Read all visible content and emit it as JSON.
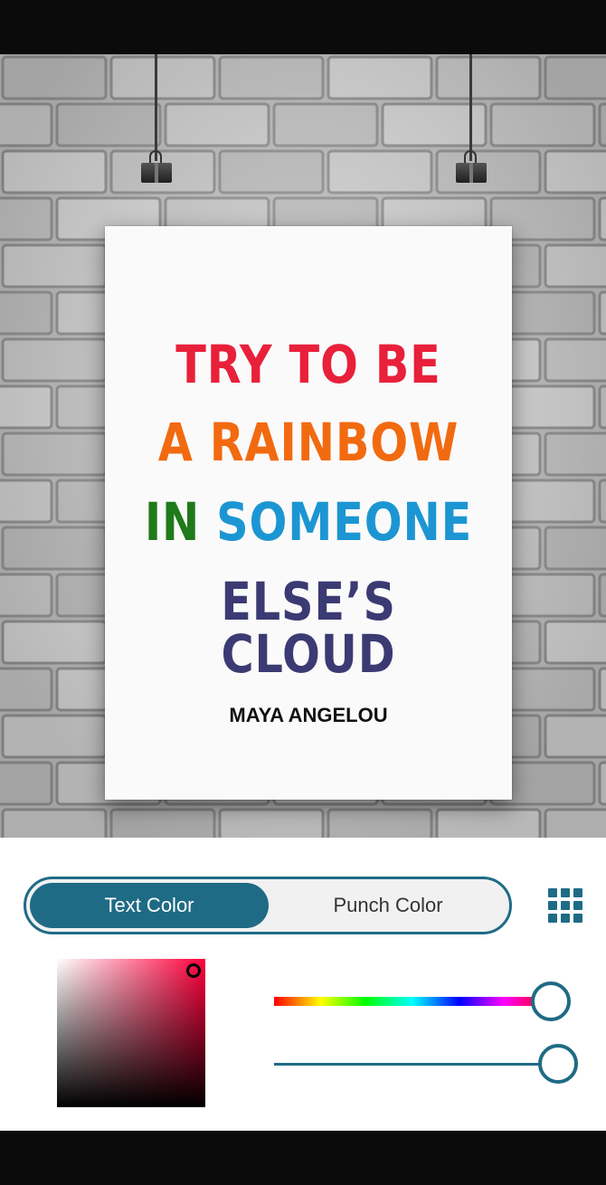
{
  "poster": {
    "lines": [
      {
        "parts": [
          {
            "text": "TRY TO BE",
            "color": "#e8203a"
          }
        ]
      },
      {
        "parts": [
          {
            "text": "A RAINBOW",
            "color": "#f26a10"
          }
        ]
      },
      {
        "parts": [
          {
            "text": "IN ",
            "color": "#1f7a1a"
          },
          {
            "text": "SOMEONE",
            "color": "#1c96d2"
          }
        ]
      },
      {
        "parts": [
          {
            "text": "ELSE’S CLOUD",
            "color": "#3b3a73"
          }
        ]
      }
    ],
    "author": "MAYA ANGELOU"
  },
  "color_panel": {
    "tabs": [
      "Text Color",
      "Punch Color"
    ],
    "active_tab": "Text Color",
    "grid_icon": "grid-icon",
    "accent": "#1f6b85",
    "picker_hue": "#ff003c",
    "hue_value": 1.0,
    "alpha_value": 1.0
  }
}
